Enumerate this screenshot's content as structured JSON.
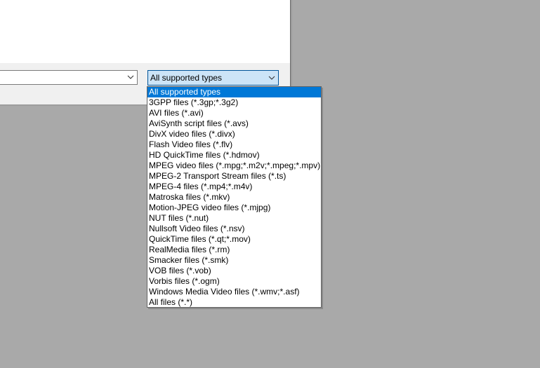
{
  "file_type_combo": {
    "value": "All supported types"
  },
  "file_name_combo": {
    "value": ""
  },
  "dropdown": {
    "selected_index": 0,
    "options": [
      "All supported types",
      "3GPP files (*.3gp;*.3g2)",
      "AVI files (*.avi)",
      "AviSynth script files (*.avs)",
      "DivX video files (*.divx)",
      "Flash Video files (*.flv)",
      "HD QuickTime files (*.hdmov)",
      "MPEG video files (*.mpg;*.m2v;*.mpeg;*.mpv)",
      "MPEG-2 Transport Stream files (*.ts)",
      "MPEG-4 files (*.mp4;*.m4v)",
      "Matroska files (*.mkv)",
      "Motion-JPEG video files (*.mjpg)",
      "NUT files (*.nut)",
      "Nullsoft Video files (*.nsv)",
      "QuickTime files (*.qt;*.mov)",
      "RealMedia files (*.rm)",
      "Smacker files (*.smk)",
      "VOB files (*.vob)",
      "Vorbis files (*.ogm)",
      "Windows Media Video files (*.wmv;*.asf)",
      "All files (*.*)"
    ]
  },
  "icons": {
    "combo_arrow": "chevron-down-icon"
  },
  "colors": {
    "desktop_background": "#a9a9a9",
    "selection": "#0078d7",
    "combo_focus_fill": "#cce4f7",
    "combo_focus_border": "#005499"
  }
}
